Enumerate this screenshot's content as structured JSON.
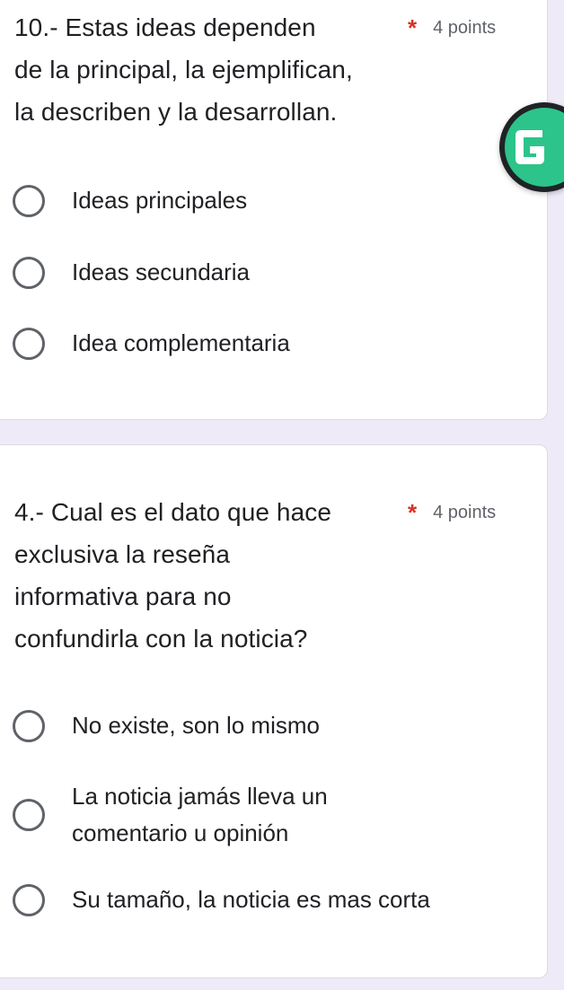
{
  "questions": [
    {
      "text": "10.- Estas ideas dependen de la principal, la ejemplifican, la describen y la desarrollan.",
      "line1": "10.- Estas ideas dependen",
      "line2": "de la principal, la ejemplifican,",
      "line3": "la describen y la desarrollan.",
      "required_mark": "*",
      "points": "4 points",
      "options": [
        "Ideas principales",
        "Ideas secundaria",
        "Idea complementaria"
      ]
    },
    {
      "line1": "4.- Cual es el dato que hace",
      "line2": "exclusiva la reseña",
      "line3": "informativa para no",
      "line4": "confundirla con la noticia?",
      "required_mark": "*",
      "points": "4 points",
      "options": [
        "No existe, son lo mismo",
        "La noticia jamás lleva un",
        "comentario u opinión",
        "Su tamaño, la noticia es mas corta"
      ]
    }
  ],
  "overlay": {
    "icon": "gauthmath-g-icon",
    "accent": "#2cc48a"
  },
  "colors": {
    "background": "#efeaf8",
    "card": "#ffffff",
    "required": "#d93025",
    "text": "#202124"
  }
}
